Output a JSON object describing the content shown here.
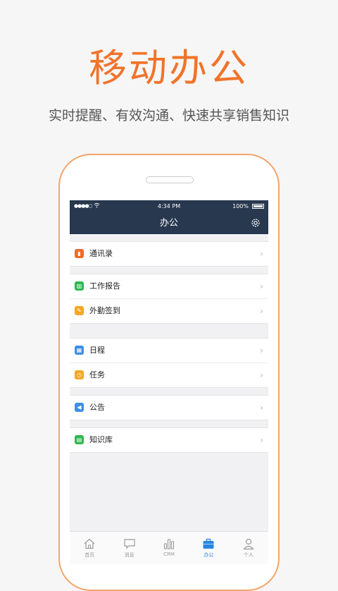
{
  "promo": {
    "title": "移动办公",
    "subtitle": "实时提醒、有效沟通、快速共享销售知识"
  },
  "status_bar": {
    "signal": "●●●●○",
    "time": "4:34 PM",
    "battery": "100%"
  },
  "nav": {
    "title": "办公"
  },
  "groups": [
    {
      "items": [
        {
          "label": "通讯录",
          "icon": "contacts-icon",
          "color": "#f26b21",
          "glyph": "▮"
        }
      ]
    },
    {
      "items": [
        {
          "label": "工作报告",
          "icon": "report-icon",
          "color": "#2eb84f",
          "glyph": "▥"
        },
        {
          "label": "外勤签到",
          "icon": "checkin-icon",
          "color": "#f5a623",
          "glyph": "✎"
        }
      ]
    },
    {
      "items": [
        {
          "label": "日程",
          "icon": "calendar-icon",
          "color": "#3b8fe6",
          "glyph": "▦"
        },
        {
          "label": "任务",
          "icon": "task-timer-icon",
          "color": "#f5a623",
          "glyph": "◷"
        }
      ]
    },
    {
      "items": [
        {
          "label": "公告",
          "icon": "announcement-icon",
          "color": "#3b8fe6",
          "glyph": "◀"
        }
      ]
    },
    {
      "items": [
        {
          "label": "知识库",
          "icon": "knowledge-base-icon",
          "color": "#2eb84f",
          "glyph": "▤"
        }
      ]
    }
  ],
  "tabs": [
    {
      "label": "首页",
      "icon": "home-icon"
    },
    {
      "label": "消息",
      "icon": "message-icon"
    },
    {
      "label": "CRM",
      "icon": "crm-chart-icon"
    },
    {
      "label": "办公",
      "icon": "office-briefcase-icon",
      "active": true
    },
    {
      "label": "个人",
      "icon": "person-icon"
    }
  ],
  "colors": {
    "accent": "#f0742b",
    "navbar": "#27384f",
    "tab_active": "#2a86e0"
  }
}
